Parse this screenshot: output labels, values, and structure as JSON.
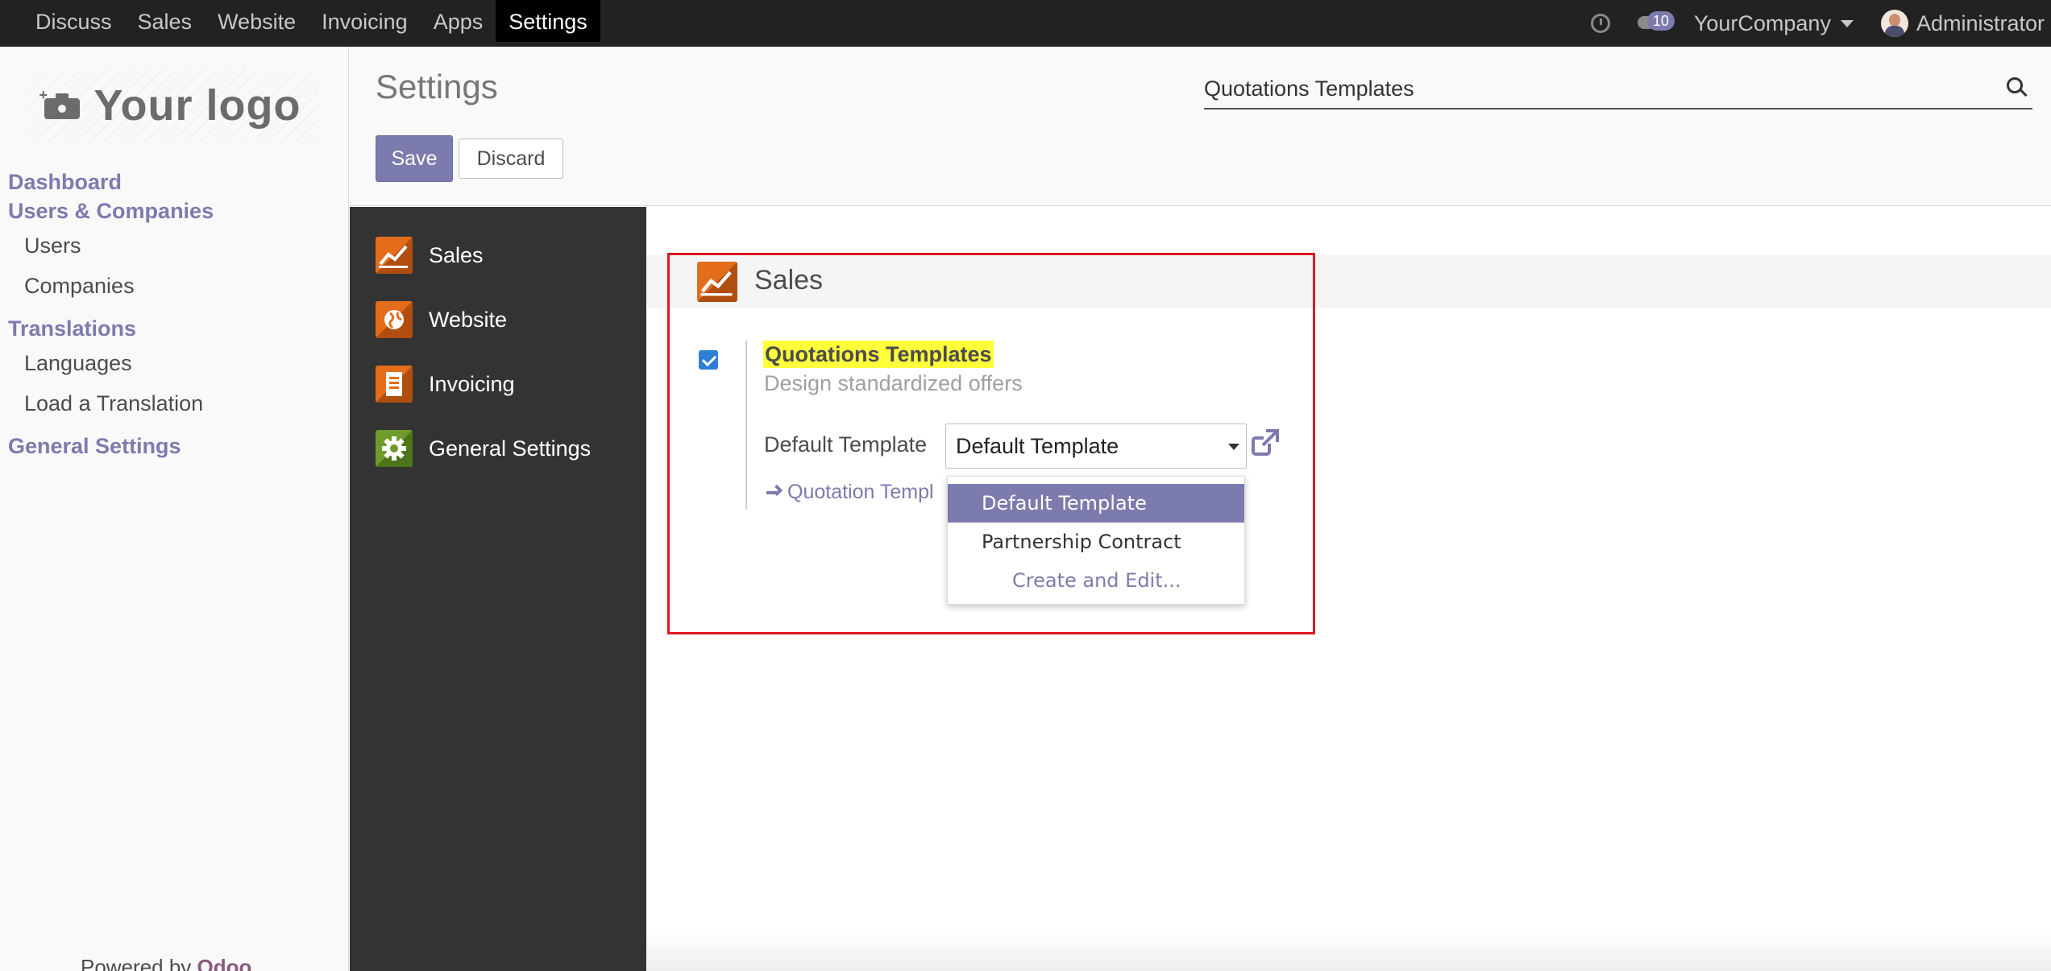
{
  "topbar": {
    "menu": [
      "Discuss",
      "Sales",
      "Website",
      "Invoicing",
      "Apps",
      "Settings"
    ],
    "active_menu": "Settings",
    "message_count": "10",
    "company": "YourCompany",
    "user": "Administrator"
  },
  "sidebar": {
    "logo_text": "Your logo",
    "sections": [
      {
        "label": "Dashboard"
      },
      {
        "label": "Users & Companies",
        "items": [
          "Users",
          "Companies"
        ]
      },
      {
        "label": "Translations",
        "items": [
          "Languages",
          "Load a Translation"
        ]
      },
      {
        "label": "General Settings"
      }
    ],
    "powered_by": "Powered by",
    "powered_brand": "Odoo"
  },
  "control_panel": {
    "title": "Settings",
    "save_label": "Save",
    "discard_label": "Discard",
    "search_value": "Quotations Templates"
  },
  "settings_nav": {
    "items": [
      {
        "label": "Sales",
        "icon": "sales-chart-icon"
      },
      {
        "label": "Website",
        "icon": "globe-icon"
      },
      {
        "label": "Invoicing",
        "icon": "invoice-document-icon"
      },
      {
        "label": "General Settings",
        "icon": "gear-icon"
      }
    ]
  },
  "section": {
    "title": "Sales",
    "setting": {
      "title": "Quotations Templates",
      "description": "Design standardized offers",
      "checked": true,
      "field_label": "Default Template",
      "field_value": "Default Template",
      "link_label": "Quotation Templ"
    },
    "dropdown": {
      "options": [
        "Default Template",
        "Partnership Contract"
      ],
      "selected": "Default Template",
      "create_label": "Create and Edit..."
    }
  },
  "colors": {
    "accent": "#7c7bad",
    "navbar": "#222222",
    "settings_nav_bg": "#333333",
    "highlight": "#ffff3b",
    "annotation_box": "#e0181f"
  }
}
